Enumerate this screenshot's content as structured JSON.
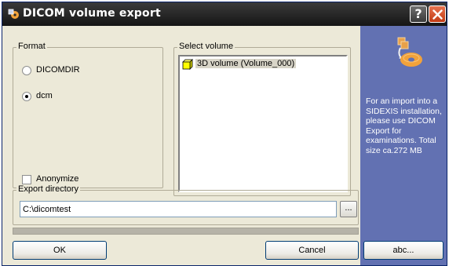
{
  "window": {
    "title": "DICOM volume export",
    "help_glyph": "?"
  },
  "format": {
    "legend": "Format",
    "options": [
      {
        "label": "DICOMDIR",
        "selected": false
      },
      {
        "label": "dcm",
        "selected": true
      }
    ],
    "anonymize_label": "Anonymize",
    "anonymize_checked": false
  },
  "volume": {
    "legend": "Select volume",
    "items": [
      {
        "label": "3D volume (Volume_000)",
        "icon": "cube-icon",
        "selected": true
      }
    ]
  },
  "export": {
    "legend": "Export directory",
    "path": "C:\\dicomtest",
    "browse_label": "..."
  },
  "buttons": {
    "ok": "OK",
    "cancel": "Cancel",
    "abc": "abc..."
  },
  "side_panel": {
    "info_text": "For an import into a SIDEXIS installation, please use DICOM Export for examinations. Total size ca.272 MB",
    "background_color": "#6271b2",
    "logo_icon": "disc-export-icon"
  }
}
